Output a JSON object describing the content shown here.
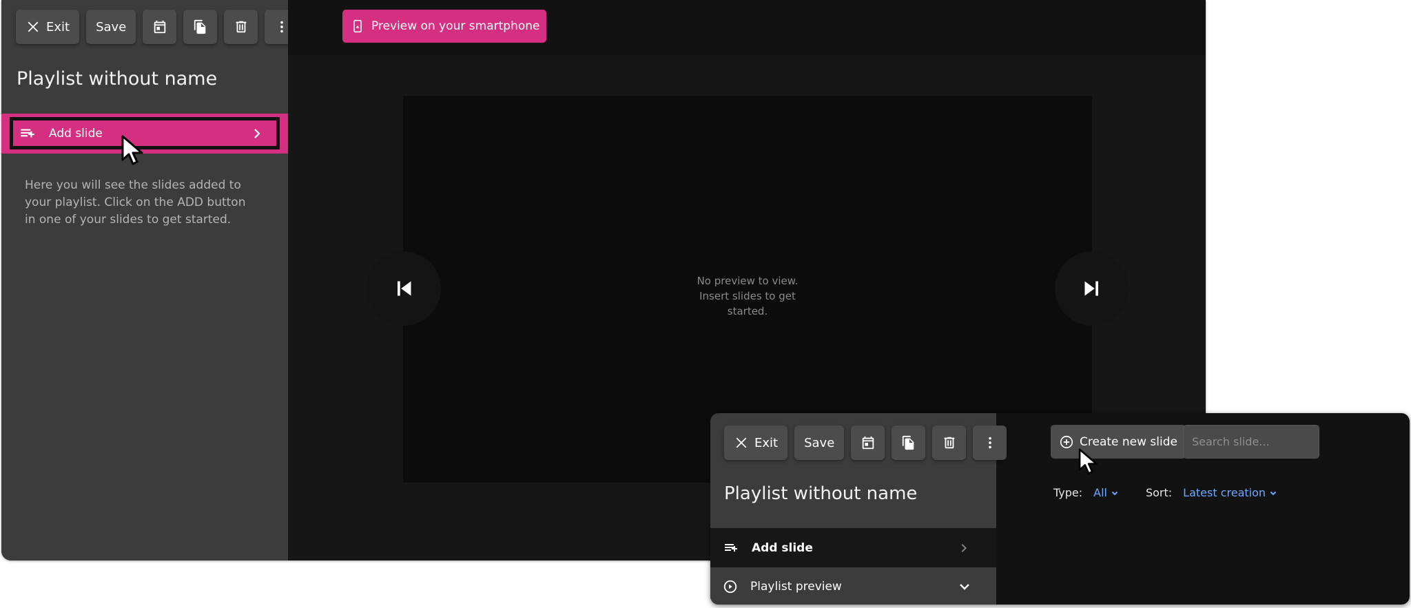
{
  "toolbar": {
    "exit_label": "Exit",
    "save_label": "Save",
    "icons": [
      "close-icon",
      "calendar-icon",
      "copy-icon",
      "trash-icon",
      "more-vertical-icon"
    ]
  },
  "playlist": {
    "title": "Playlist without name"
  },
  "sidebar": {
    "add_slide_label": "Add slide",
    "help_text": "Here you will see the slides added to your playlist. Click on the ADD button in one of your slides to get started.",
    "playlist_preview_label": "Playlist preview"
  },
  "header": {
    "preview_phone_label": "Preview on your smartphone"
  },
  "preview": {
    "empty_text": "No preview to view. Insert slides to get started."
  },
  "slides_panel": {
    "create_label": "Create new slide",
    "search_placeholder": "Search slide...",
    "type_label": "Type:",
    "type_value": "All",
    "sort_label": "Sort:",
    "sort_value": "Latest creation"
  },
  "colors": {
    "accent": "#d52f82",
    "sidebar_bg": "#3c3c3c",
    "canvas_bg": "#161616",
    "link": "#6ea8ff"
  }
}
